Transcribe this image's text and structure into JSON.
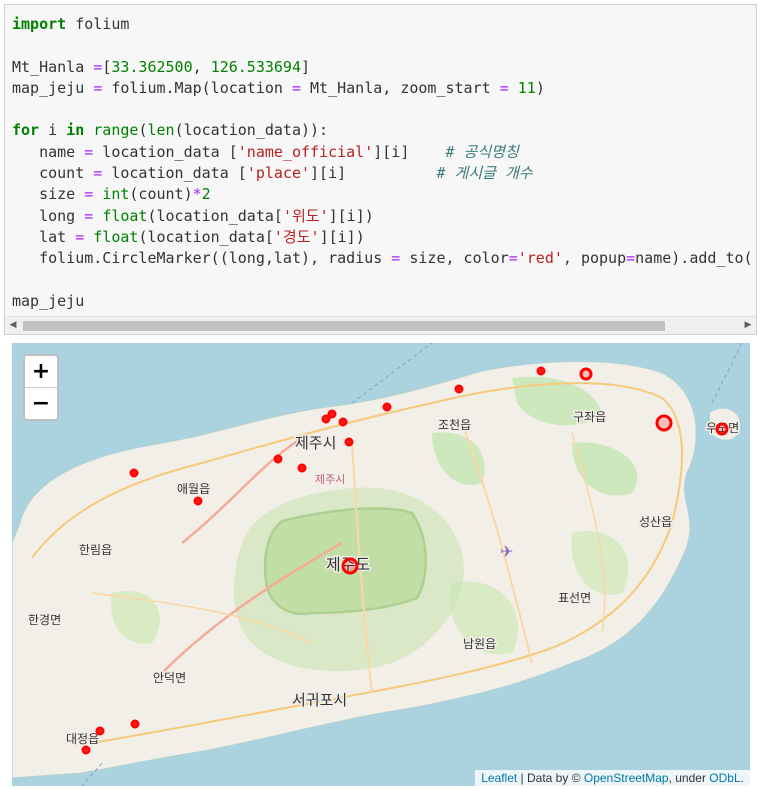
{
  "code_lines": [
    [
      [
        "kw",
        "import"
      ],
      [
        "",
        "  folium"
      ]
    ],
    [],
    [
      [
        "",
        "Mt_Hanla "
      ],
      [
        "op",
        "="
      ],
      [
        "",
        "["
      ],
      [
        "num",
        "33.362500"
      ],
      [
        "",
        ", "
      ],
      [
        "num",
        "126.533694"
      ],
      [
        "",
        "]"
      ]
    ],
    [
      [
        "",
        "map_jeju "
      ],
      [
        "op",
        "="
      ],
      [
        "",
        ""
      ],
      [
        "",
        ""
      ],
      [
        "",
        "  folium.Map(location "
      ],
      [
        "op",
        "="
      ],
      [
        "",
        ""
      ],
      [
        "",
        "  Mt_Hanla, zoom_start "
      ],
      [
        "op",
        "="
      ],
      [
        "",
        ""
      ],
      [
        "",
        "  "
      ],
      [
        "num",
        "11"
      ],
      [
        "",
        ")"
      ]
    ],
    [],
    [
      [
        "kw",
        "for"
      ],
      [
        "",
        ""
      ],
      [
        "",
        "  i "
      ],
      [
        "kw",
        "in"
      ],
      [
        "",
        ""
      ],
      [
        "",
        "  "
      ],
      [
        "bi",
        "range"
      ],
      [
        "",
        "("
      ],
      [
        "bi",
        "len"
      ],
      [
        "",
        "(location_data)):"
      ]
    ],
    [
      [
        "",
        "    name "
      ],
      [
        "op",
        "="
      ],
      [
        "",
        ""
      ],
      [
        "",
        "  location_data ["
      ],
      [
        "str",
        "'name_official'"
      ],
      [
        "",
        "][i]    "
      ],
      [
        "cm",
        "# 공식명칭"
      ]
    ],
    [
      [
        "",
        "    count "
      ],
      [
        "op",
        "="
      ],
      [
        "",
        ""
      ],
      [
        "",
        "  location_data ["
      ],
      [
        "str",
        "'place'"
      ],
      [
        "",
        "][i]          "
      ],
      [
        "cm",
        "# 게시글 개수"
      ]
    ],
    [
      [
        "",
        "    size "
      ],
      [
        "op",
        "="
      ],
      [
        "",
        ""
      ],
      [
        "",
        "  "
      ],
      [
        "bi",
        "int"
      ],
      [
        "",
        "(count)"
      ],
      [
        "op",
        "*"
      ],
      [
        "num",
        "2"
      ]
    ],
    [
      [
        "",
        "    long "
      ],
      [
        "op",
        "="
      ],
      [
        "",
        ""
      ],
      [
        "",
        "  "
      ],
      [
        "bi",
        "float"
      ],
      [
        "",
        "(location_data["
      ],
      [
        "str",
        "'위도'"
      ],
      [
        "",
        "][i])"
      ]
    ],
    [
      [
        "",
        "    lat "
      ],
      [
        "op",
        "="
      ],
      [
        "",
        ""
      ],
      [
        "",
        "  "
      ],
      [
        "bi",
        "float"
      ],
      [
        "",
        "(location_data["
      ],
      [
        "str",
        "'경도'"
      ],
      [
        "",
        "][i])"
      ]
    ],
    [
      [
        "",
        "    folium.CircleMarker((long,lat), radius "
      ],
      [
        "op",
        "="
      ],
      [
        "",
        ""
      ],
      [
        "",
        "  size, color"
      ],
      [
        "op",
        "="
      ],
      [
        "str",
        "'red'"
      ],
      [
        "",
        ", popup"
      ],
      [
        "op",
        "="
      ],
      [
        "",
        "name).add_to("
      ]
    ],
    [],
    [
      [
        "",
        "map_jeju"
      ]
    ]
  ],
  "scrollbar": {
    "left_arrow": "◀",
    "right_arrow": "▶"
  },
  "map": {
    "zoom_in": "+",
    "zoom_out": "−",
    "attribution": {
      "leaflet": "Leaflet",
      "data_by": " | Data by © ",
      "osm": "OpenStreetMap",
      "under": ", under ",
      "license": "ODbL",
      "end": "."
    },
    "place_labels": {
      "jeju_city": "제주시",
      "jeju_city_small": "제주시",
      "jocheon": "조천읍",
      "gujwa": "구좌읍",
      "udo": "우도면",
      "aewol": "애월읍",
      "hallim": "한림읍",
      "hangyeong": "한경면",
      "island": "제주도",
      "seongsan": "성산읍",
      "pyoseon": "표선면",
      "namwon": "남원읍",
      "andeok": "안덕면",
      "seogwipo": "서귀포시",
      "daejeong": "대정읍"
    },
    "marker_color": "#ff0000"
  }
}
